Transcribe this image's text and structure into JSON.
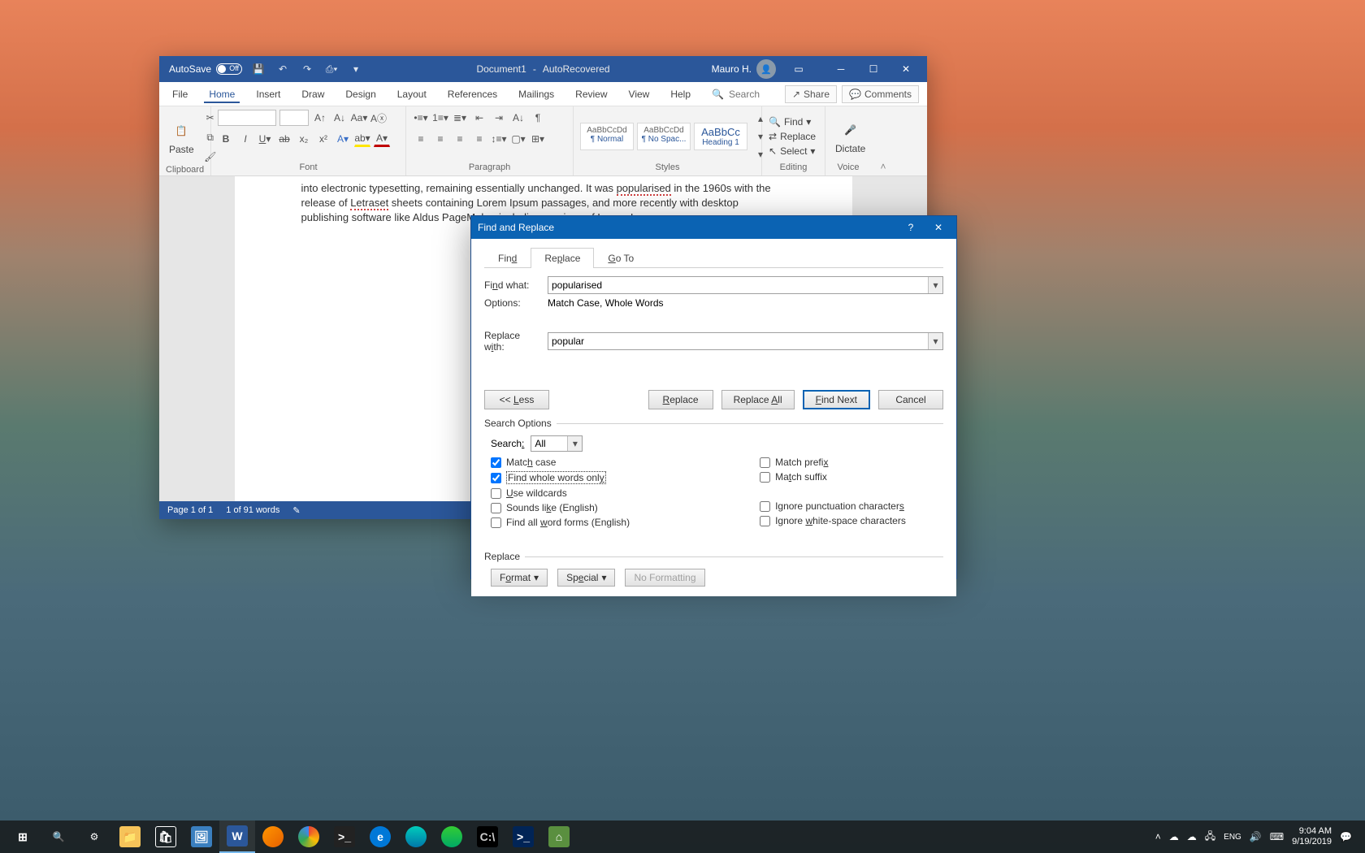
{
  "titlebar": {
    "autosave_label": "AutoSave",
    "autosave_state": "Off",
    "doc_name": "Document1",
    "doc_suffix": "AutoRecovered",
    "user": "Mauro H."
  },
  "menu": {
    "file": "File",
    "home": "Home",
    "insert": "Insert",
    "draw": "Draw",
    "design": "Design",
    "layout": "Layout",
    "references": "References",
    "mailings": "Mailings",
    "review": "Review",
    "view": "View",
    "help": "Help",
    "tellme": "Search",
    "share": "Share",
    "comments": "Comments"
  },
  "ribbon": {
    "clipboard": {
      "paste": "Paste",
      "label": "Clipboard"
    },
    "font": {
      "label": "Font"
    },
    "paragraph": {
      "label": "Paragraph"
    },
    "styles": {
      "label": "Styles",
      "items": [
        {
          "preview": "AaBbCcDd",
          "name": "¶ Normal"
        },
        {
          "preview": "AaBbCcDd",
          "name": "¶ No Spac..."
        },
        {
          "preview": "AaBbCc",
          "name": "Heading 1"
        }
      ]
    },
    "editing": {
      "find": "Find",
      "replace": "Replace",
      "select": "Select",
      "label": "Editing"
    },
    "voice": {
      "dictate": "Dictate",
      "label": "Voice"
    }
  },
  "document": {
    "line1a": "into electronic typesetting, remaining essentially unchanged. It was ",
    "line1_hl": "popularised",
    "line1b": " in the 1960s with the release of ",
    "line1_hl2": "Letraset",
    "line1c": " sheets containing Lorem Ipsum passages, and more recently with desktop publishing software like Aldus PageMaker including versions of Lorem Ipsum."
  },
  "statusbar": {
    "page": "Page 1 of 1",
    "words": "1 of 91 words"
  },
  "dialog": {
    "title": "Find and Replace",
    "tabs": {
      "find": "Find",
      "replace": "Replace",
      "goto": "Go To"
    },
    "find_label": "Find what:",
    "find_value": "popularised",
    "options_label": "Options:",
    "options_value": "Match Case, Whole Words",
    "replace_label": "Replace with:",
    "replace_value": "popular",
    "btn_less": "<< Less",
    "btn_replace": "Replace",
    "btn_replace_all": "Replace All",
    "btn_find_next": "Find Next",
    "btn_cancel": "Cancel",
    "search_options": "Search Options",
    "search_label": "Search:",
    "search_dir": "All",
    "checks": {
      "match_case": "Match case",
      "whole_words": "Find whole words only",
      "wildcards": "Use wildcards",
      "sounds_like": "Sounds like (English)",
      "word_forms": "Find all word forms (English)",
      "match_prefix": "Match prefix",
      "match_suffix": "Match suffix",
      "ignore_punct": "Ignore punctuation characters",
      "ignore_ws": "Ignore white-space characters"
    },
    "replace_section": "Replace",
    "btn_format": "Format",
    "btn_special": "Special",
    "btn_noformat": "No Formatting"
  },
  "taskbar": {
    "time": "9:04 AM",
    "date": "9/19/2019"
  }
}
